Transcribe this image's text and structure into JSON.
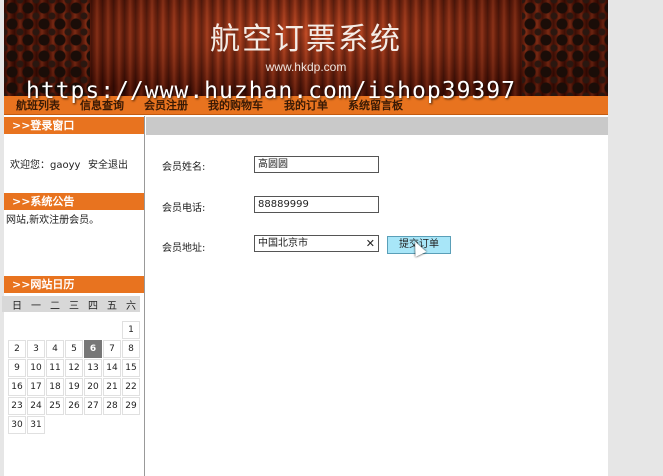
{
  "header": {
    "title": "航空订票系统",
    "url": "www.hkdp.com",
    "watermark": "https://www.huzhan.com/ishop39397"
  },
  "nav": [
    "航班列表",
    "信息查询",
    "会员注册",
    "我的购物车",
    "我的订单",
    "系统留言板"
  ],
  "login_panel": {
    "title": ">>登录窗口",
    "welcome": "欢迎您：gaoyy",
    "logout": "安全退出"
  },
  "notice_panel": {
    "title": ">>系统公告",
    "text": "网站,新欢注册会员。"
  },
  "calendar_panel": {
    "title": ">>网站日历",
    "day_names": [
      "日",
      "一",
      "二",
      "三",
      "四",
      "五",
      "六"
    ],
    "weeks": [
      [
        "",
        "",
        "",
        "",
        "",
        "",
        "1"
      ],
      [
        "2",
        "3",
        "4",
        "5",
        "6",
        "7",
        "8"
      ],
      [
        "9",
        "10",
        "11",
        "12",
        "13",
        "14",
        "15"
      ],
      [
        "16",
        "17",
        "18",
        "19",
        "20",
        "21",
        "22"
      ],
      [
        "23",
        "24",
        "25",
        "26",
        "27",
        "28",
        "29"
      ],
      [
        "30",
        "31",
        "",
        "",
        "",
        "",
        ""
      ]
    ],
    "today": "6"
  },
  "form": {
    "name_label": "会员姓名:",
    "name_value": "高圆圆",
    "phone_label": "会员电话:",
    "phone_value": "88889999",
    "address_label": "会员地址:",
    "address_value": "中国北京市",
    "clear_symbol": "✕",
    "submit_label": "提交订单"
  },
  "colors": {
    "accent": "#e8731f",
    "button": "#a8e6f8"
  }
}
